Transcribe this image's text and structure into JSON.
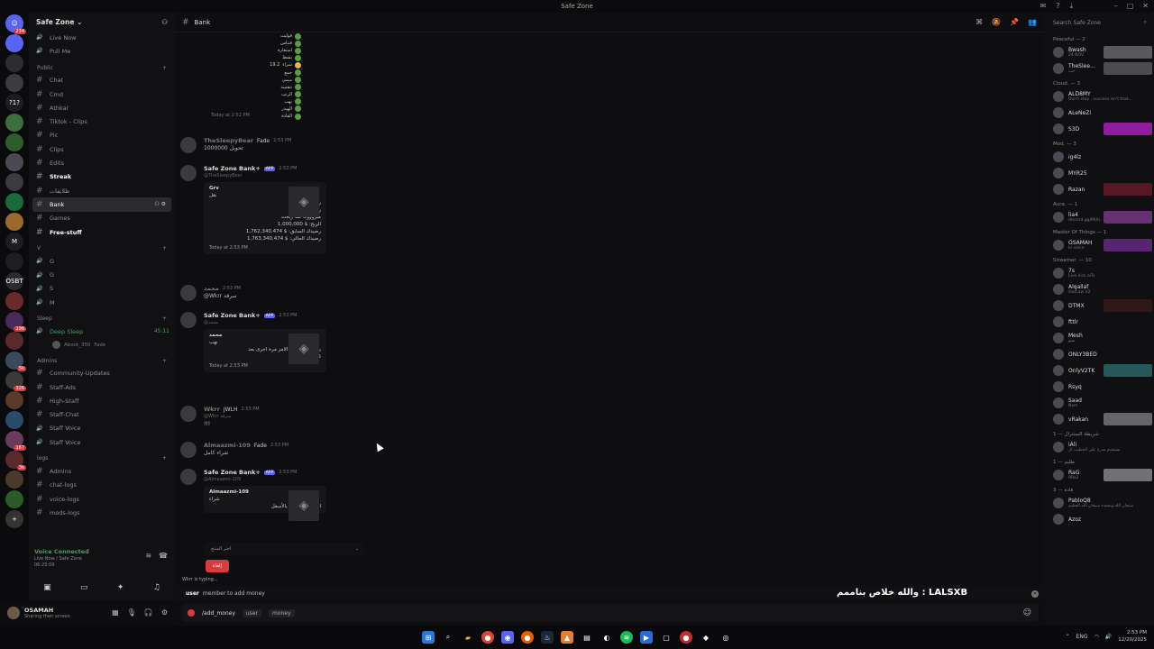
{
  "titlebar": {
    "title": "Safe Zone"
  },
  "guilds": {
    "top_badge": "234",
    "items": [
      {
        "color": "#5865f2",
        "label": "",
        "badge": ""
      },
      {
        "color": "#2b2d31",
        "label": "",
        "badge": ""
      },
      {
        "color": "#3a3a40",
        "label": "",
        "badge": ""
      },
      {
        "color": "#1e1e22",
        "label": "?1?",
        "badge": ""
      },
      {
        "color": "#3d6d3d",
        "label": "",
        "badge": ""
      },
      {
        "color": "#2d5d2d",
        "label": "",
        "badge": ""
      },
      {
        "color": "#4a4a52",
        "label": "",
        "badge": ""
      },
      {
        "color": "#3a3a40",
        "label": "",
        "badge": ""
      },
      {
        "color": "#1a6a3a",
        "label": "",
        "badge": ""
      },
      {
        "color": "#9a6a2a",
        "label": "",
        "badge": ""
      },
      {
        "color": "#1e1e22",
        "label": "M",
        "badge": ""
      },
      {
        "color": "#1e1e22",
        "label": "",
        "badge": ""
      },
      {
        "color": "#2a2a30",
        "label": "OSBT",
        "badge": ""
      },
      {
        "color": "#6a2a2a",
        "label": "",
        "badge": ""
      },
      {
        "color": "#4a2a5a",
        "label": "",
        "badge": "196"
      },
      {
        "color": "#5a2a2a",
        "label": "",
        "badge": ""
      },
      {
        "color": "#3a4a5a",
        "label": "",
        "badge": "5k"
      },
      {
        "color": "#3a3a3a",
        "label": "",
        "badge": "326"
      },
      {
        "color": "#5a3a2a",
        "label": "",
        "badge": ""
      },
      {
        "color": "#2a4a6a",
        "label": "",
        "badge": ""
      },
      {
        "color": "#6a3a5a",
        "label": "",
        "badge": "167"
      },
      {
        "color": "#5a2a2a",
        "label": "",
        "badge": "3k"
      },
      {
        "color": "#4a3a2a",
        "label": "",
        "badge": ""
      },
      {
        "color": "#2a5a2a",
        "label": "",
        "badge": ""
      },
      {
        "color": "#333",
        "label": "+",
        "badge": ""
      }
    ]
  },
  "server": {
    "name": "Safe Zone"
  },
  "channels": {
    "top": [
      {
        "label": "Live Now",
        "type": "voice"
      },
      {
        "label": "Pull Me",
        "type": "voice"
      }
    ],
    "public_cat": "Public",
    "public": [
      {
        "label": "Chat",
        "bold": false
      },
      {
        "label": "Cmd",
        "bold": false
      },
      {
        "label": "Athkar",
        "bold": false
      },
      {
        "label": "Tiktok - Clips",
        "bold": false
      },
      {
        "label": "Pic",
        "bold": false
      },
      {
        "label": "Clips",
        "bold": false
      },
      {
        "label": "Edits",
        "bold": false
      },
      {
        "label": "Streak",
        "bold": true
      },
      {
        "label": "ظلايفات",
        "bold": false
      },
      {
        "label": "Bank",
        "bold": false,
        "active": true
      },
      {
        "label": "Games",
        "bold": false
      },
      {
        "label": "Free-stuff",
        "bold": true
      }
    ],
    "v_cat": "V",
    "v": [
      "G",
      "G",
      "S",
      "M"
    ],
    "sleep_cat": "Sleep",
    "sleep_channel": "Deep Sleep",
    "sleep_time": "45:11",
    "sleep_user": "Aboot_350",
    "sleep_user_tag": "Fade",
    "admins_cat": "Admins",
    "admins": [
      "Community-Updates",
      "Staff-Ads",
      "High-Staff",
      "Staff-Chat",
      "Staff Voice",
      "Staff Voice"
    ],
    "logs_cat": "logs",
    "logs": [
      "Admins",
      "chat-logs",
      "voice-logs",
      "mods-logs"
    ]
  },
  "voice": {
    "status": "Voice Connected",
    "location": "Live Now / Safe Zone",
    "time": "06:25:09"
  },
  "user": {
    "name": "OSAMAH",
    "status": "Sharing their screen"
  },
  "header": {
    "channel": "Bank",
    "search_placeholder": "Search Safe Zone"
  },
  "dotlist": {
    "labels": [
      "فوليت",
      "قتباس",
      "استغارة",
      "نشط",
      "شراء",
      "جمع",
      "ميمي",
      "تتقتبيد",
      "الرتب",
      "نهب",
      "الهيدر",
      "القادة"
    ],
    "amount": "19.2",
    "time": "Today at 2:52 PM"
  },
  "messages": [
    {
      "name": "TheSleepyBear",
      "tag": "Fade",
      "time": "2:53 PM",
      "text": "تحويل 1000000"
    },
    {
      "name": "Safe Zone Bank+",
      "app": "APP",
      "time": "2:53 PM",
      "reply": "@TheSleepyBear",
      "embed": {
        "user": "Grv",
        "title": "نقل",
        "lines": [
          "رقمي : 3",
          "رقمك : 3",
          "مبروووك لقد ربحت",
          "1,000,000 $ :الربح",
          "1,762,340,474 $ :رصيدك السابق",
          "1,763,340,474 $ :رصيدك الحالي"
        ],
        "footer": "Today at 2:53 PM"
      }
    },
    {
      "name": "محمد",
      "time": "2:53 PM",
      "text": "@Wkrr سرقة"
    },
    {
      "name": "Safe Zone Bank+",
      "app": "APP",
      "time": "2:53 PM",
      "reply": "@محمد",
      "embed": {
        "user": "محمد",
        "title": "نهب",
        "lines": [
          "يمكنك استخدام الامر مرة اخرى بعد",
          "19:13.5"
        ],
        "footer": "Today at 2:53 PM"
      }
    },
    {
      "name": "Wkrr",
      "tag": "JWLH",
      "time": "2:53 PM",
      "reply": "@Wkrr سرقة",
      "text": "!!!"
    },
    {
      "name": "Almaazmi-109",
      "tag": "Fade",
      "time": "2:53 PM",
      "text": "شراء كامل"
    },
    {
      "name": "Safe Zone Bank+",
      "app": "APP",
      "time": "2:53 PM",
      "reply": "@Almaazmi-109",
      "embed": {
        "user": "Almaazmi-109",
        "title": "شراء",
        "lines": [
          "اختر من القائمة بالأسفل"
        ],
        "footer": ""
      }
    }
  ],
  "select": {
    "placeholder": "اختر المنتج"
  },
  "buy_button": "إلغاء",
  "typing": "Wkrr is typing...",
  "cmdhint": {
    "kw": "user",
    "text": "member to add money"
  },
  "overlay": "والله خلاص بناممم : LALSXB",
  "composer": {
    "cmd": "/add_money",
    "opt1": "user",
    "opt2": "money"
  },
  "members": {
    "groups": [
      {
        "title": "Peaceful — 2",
        "items": [
          {
            "name": "Bwash",
            "sub": "24 NOV",
            "banner": "#6a6a72"
          },
          {
            "name": "TheSlee...",
            "sub": "حب",
            "banner": "#5a5a62"
          }
        ]
      },
      {
        "title": "Cloud. — 3",
        "items": [
          {
            "name": "ALD8MY",
            "sub": "Don't stop . success isn't that...",
            "banner": ""
          },
          {
            "name": "ALeNeZi",
            "sub": "",
            "banner": ""
          },
          {
            "name": "S3D",
            "sub": "",
            "banner": "#b020c0"
          }
        ]
      },
      {
        "title": "Mod. — 3",
        "items": [
          {
            "name": "ig4lz",
            "sub": "",
            "banner": ""
          },
          {
            "name": "MYR25",
            "sub": "",
            "banner": ""
          },
          {
            "name": "Razan",
            "sub": "",
            "banner": "#6a1a2a"
          }
        ]
      },
      {
        "title": "Aura. — 1",
        "items": [
          {
            "name": "lia4",
            "sub": "discord.gg/MUU",
            "banner": "#7a3a8a"
          }
        ]
      },
      {
        "title": "Master Of Things — 1",
        "items": [
          {
            "name": "OSAMAH",
            "sub": "In voice",
            "banner": "#6a2a8a"
          }
        ]
      },
      {
        "title": "Streamer. — 10",
        "items": [
          {
            "name": "7s",
            "sub": "Live kick alTs",
            "banner": ""
          },
          {
            "name": "Alqallaf",
            "sub": "OutLaw V2",
            "banner": ""
          },
          {
            "name": "DTMX",
            "sub": "",
            "banner": "#3a1a1a"
          },
          {
            "name": "fttlr",
            "sub": "",
            "banner": ""
          },
          {
            "name": "Mesh",
            "sub": "شنو",
            "banner": ""
          },
          {
            "name": "ONLY3BED",
            "sub": "",
            "banner": ""
          },
          {
            "name": "OnlyV2TK",
            "sub": "",
            "banner": "#2a6a6a"
          },
          {
            "name": "Rsyq",
            "sub": "",
            "banner": ""
          },
          {
            "name": "Saad",
            "sub": "Nom",
            "banner": ""
          },
          {
            "name": "vRakan",
            "sub": "",
            "banner": "#7a7a82"
          }
        ]
      },
      {
        "title": "1 — شريطة السنترال",
        "items": [
          {
            "name": "iAli",
            "sub": "تستخدم مدرج على الخطيب ال",
            "banner": ""
          }
        ]
      },
      {
        "title": "طليم — 1",
        "items": [
          {
            "name": "RaG",
            "sub": "9Ra2",
            "banner": "#8a8a92"
          }
        ]
      },
      {
        "title": "قادة — 3",
        "items": [
          {
            "name": "PabloQ8",
            "sub": "سبحان الله وبحمده سبحان الله العظيم",
            "banner": ""
          },
          {
            "name": "Azoz",
            "sub": "",
            "banner": ""
          }
        ]
      }
    ]
  },
  "taskbar": {
    "lang": "ENG",
    "time": "2:53 PM",
    "date": "12/20/2025"
  }
}
